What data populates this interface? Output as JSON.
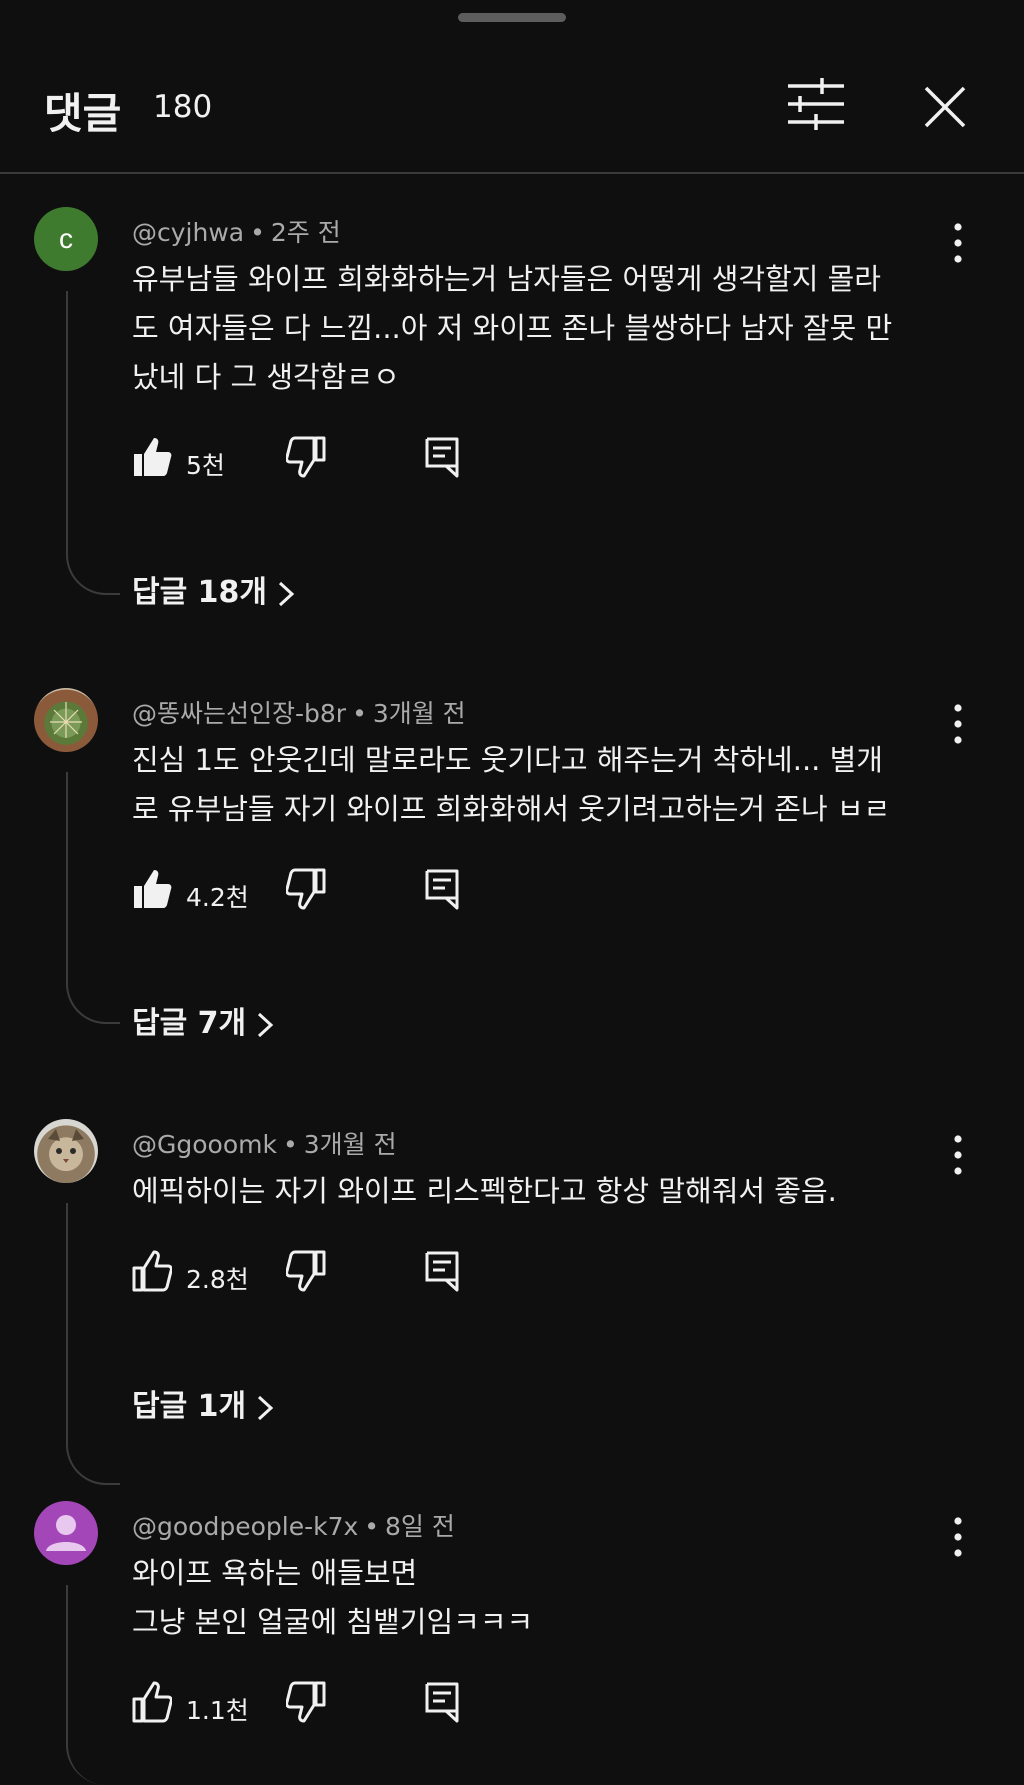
{
  "header": {
    "title": "댓글",
    "count": "180"
  },
  "comments": [
    {
      "avatar_letter": "c",
      "author": "@cyjhwa",
      "time": "2주 전",
      "text": "유부남들 와이프 희화화하는거 남자들은 어떻게 생각할지 몰라\n도 여자들은 다 느낌...아 저 와이프 존나 블쌍하다 남자 잘못 만\n났네 다 그 생각함ㄹㅇ",
      "likes": "5천",
      "liked": true,
      "replies": "답글 18개"
    },
    {
      "author": "@똥싸는선인장-b8r",
      "time": "3개월 전",
      "text": "진심 1도 안웃긴데 말로라도 웃기다고 해주는거 착하네... 별개\n로 유부남들 자기 와이프 희화화해서 웃기려고하는거 존나 ㅂㄹ",
      "likes": "4.2천",
      "liked": true,
      "replies": "답글 7개"
    },
    {
      "author": "@Ggooomk",
      "time": "3개월 전",
      "text": "에픽하이는 자기 와이프 리스펙한다고 항상 말해줘서 좋음.",
      "likes": "2.8천",
      "liked": false,
      "replies": "답글 1개"
    },
    {
      "author": "@goodpeople-k7x",
      "time": "8일 전",
      "text": "와이프 욕하는 애들보면\n그냥 본인 얼굴에 침뱉기임ㅋㅋㅋ",
      "likes": "1.1천",
      "liked": false
    }
  ],
  "colors": {
    "background": "#0f0f0f",
    "text": "#f1f1f1",
    "secondary_text": "#aaaaaa",
    "avatar_green": "#3f7b2f",
    "avatar_purple": "#a347b8"
  }
}
